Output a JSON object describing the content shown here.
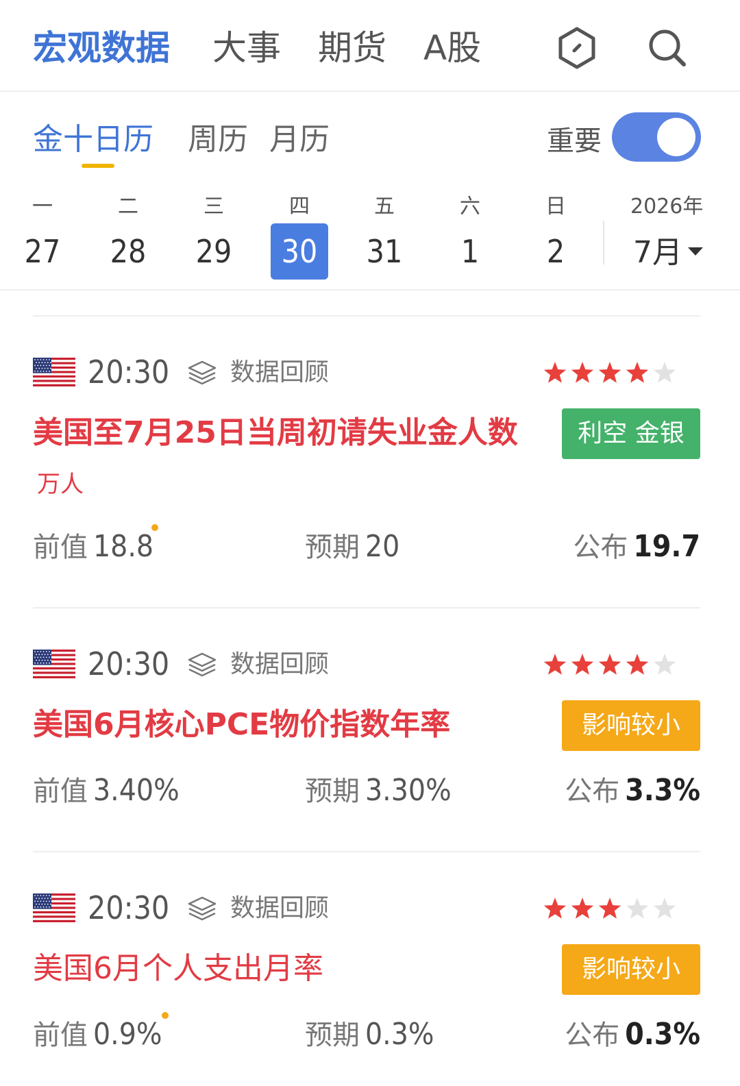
{
  "topnav": {
    "tabs": [
      {
        "label": "宏观数据",
        "active": true
      },
      {
        "label": "大事",
        "active": false
      },
      {
        "label": "期货",
        "active": false
      },
      {
        "label": "A股",
        "active": false
      }
    ],
    "icons": [
      "hexagon-icon",
      "search-icon"
    ]
  },
  "subtabs": {
    "tabs": [
      {
        "label": "金十日历",
        "active": true
      },
      {
        "label": "周历",
        "active": false
      },
      {
        "label": "月历",
        "active": false
      }
    ],
    "important_label": "重要",
    "important_on": true
  },
  "calendar": {
    "days": [
      {
        "weekday": "一",
        "date": "27",
        "selected": false
      },
      {
        "weekday": "二",
        "date": "28",
        "selected": false
      },
      {
        "weekday": "三",
        "date": "29",
        "selected": false
      },
      {
        "weekday": "四",
        "date": "30",
        "selected": true
      },
      {
        "weekday": "五",
        "date": "31",
        "selected": false
      },
      {
        "weekday": "六",
        "date": "1",
        "selected": false
      },
      {
        "weekday": "日",
        "date": "2",
        "selected": false
      }
    ],
    "year": "2026年",
    "month": "7月"
  },
  "events": [
    {
      "country_flag": "us-flag-icon",
      "time": "20:30",
      "review_label": "数据回顾",
      "stars": 4,
      "title": "美国至7月25日当周初请失业金人数",
      "unit": "万人",
      "badge": "利空 金银",
      "badge_color": "#44b26a",
      "previous_label": "前值",
      "previous": "18.8",
      "previous_revised": true,
      "expected_label": "预期",
      "expected": "20",
      "published_label": "公布",
      "published": "19.7"
    },
    {
      "country_flag": "us-flag-icon",
      "time": "20:30",
      "review_label": "数据回顾",
      "stars": 4,
      "title": "美国6月核心PCE物价指数年率",
      "unit": "",
      "badge": "影响较小",
      "badge_color": "#f5a818",
      "previous_label": "前值",
      "previous": "3.40%",
      "previous_revised": false,
      "expected_label": "预期",
      "expected": "3.30%",
      "published_label": "公布",
      "published": "3.3%"
    },
    {
      "country_flag": "us-flag-icon",
      "time": "20:30",
      "review_label": "数据回顾",
      "stars": 3,
      "title": "美国6月个人支出月率",
      "unit": "",
      "badge": "影响较小",
      "badge_color": "#f5a818",
      "previous_label": "前值",
      "previous": "0.9%",
      "previous_revised": true,
      "expected_label": "预期",
      "expected": "0.3%",
      "published_label": "公布",
      "published": "0.3%"
    }
  ],
  "colors": {
    "accent": "#3f74d6",
    "title_red": "#e23b44",
    "star_red": "#e8403a",
    "star_gray": "#e2e2e2"
  }
}
